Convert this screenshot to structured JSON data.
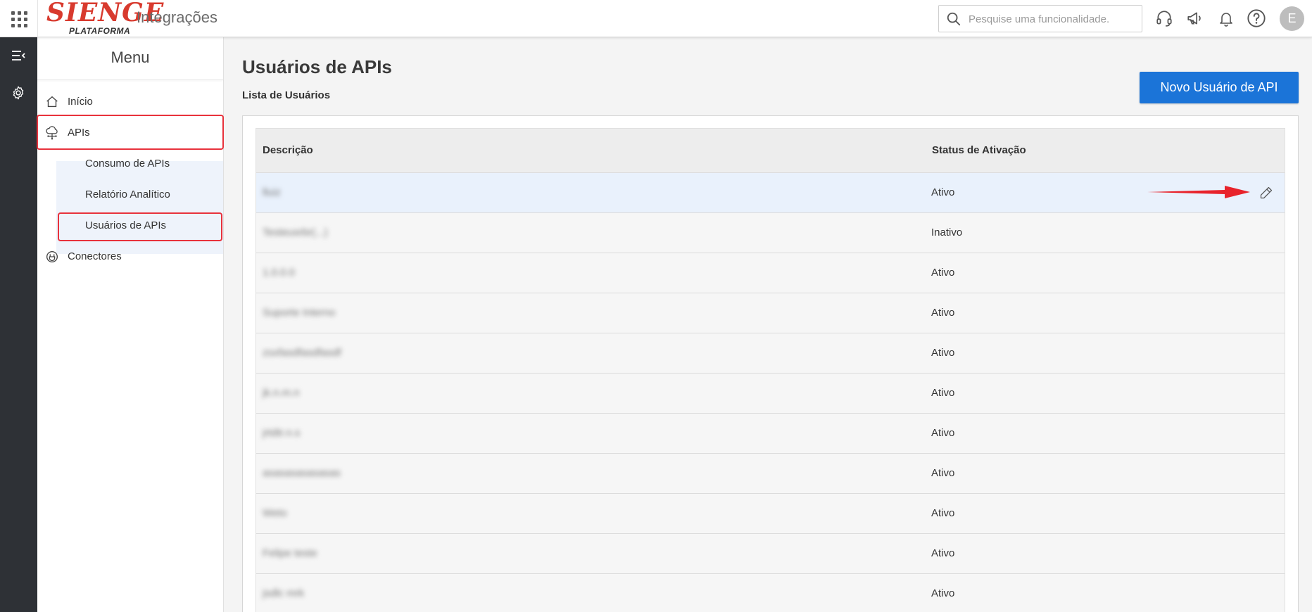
{
  "header": {
    "logo_main": "SIENGE",
    "logo_sub": "PLATAFORMA",
    "app_name": "Integrações",
    "search_placeholder": "Pesquise uma funcionalidade.",
    "avatar_initial": "E"
  },
  "menu": {
    "title": "Menu",
    "items": [
      {
        "label": "Início",
        "icon": "home-icon"
      },
      {
        "label": "APIs",
        "icon": "cloud-network-icon"
      },
      {
        "label": "Conectores",
        "icon": "connector-icon"
      }
    ],
    "sub_items": [
      {
        "label": "Consumo de APIs"
      },
      {
        "label": "Relatório Analítico"
      },
      {
        "label": "Usuários de APIs"
      }
    ]
  },
  "main": {
    "title": "Usuários de APIs",
    "subtitle": "Lista de Usuários",
    "new_button": "Novo Usuário de API"
  },
  "table": {
    "columns": [
      "Descrição",
      "Status de Ativação"
    ],
    "rows": [
      {
        "desc": "lluiz",
        "status": "Ativo"
      },
      {
        "desc": "Testeusrbr(...)",
        "status": "Inativo"
      },
      {
        "desc": "1.0.0.0",
        "status": "Ativo"
      },
      {
        "desc": "Suporte Interno",
        "status": "Ativo"
      },
      {
        "desc": "zsxfasdfasdfasdf",
        "status": "Ativo"
      },
      {
        "desc": "jk.n.m.n",
        "status": "Ativo"
      },
      {
        "desc": "jrtdtr.n.s",
        "status": "Ativo"
      },
      {
        "desc": "asasasasasasas",
        "status": "Ativo"
      },
      {
        "desc": "Weto",
        "status": "Ativo"
      },
      {
        "desc": "Felipe teste",
        "status": "Ativo"
      },
      {
        "desc": "jsdlc mrk",
        "status": "Ativo"
      }
    ]
  },
  "colors": {
    "brand_red": "#d83a2e",
    "primary_blue": "#1b74d8",
    "rail_dark": "#2e3136",
    "highlight_red": "#e8323c",
    "selected_row": "#e9f1fc"
  }
}
